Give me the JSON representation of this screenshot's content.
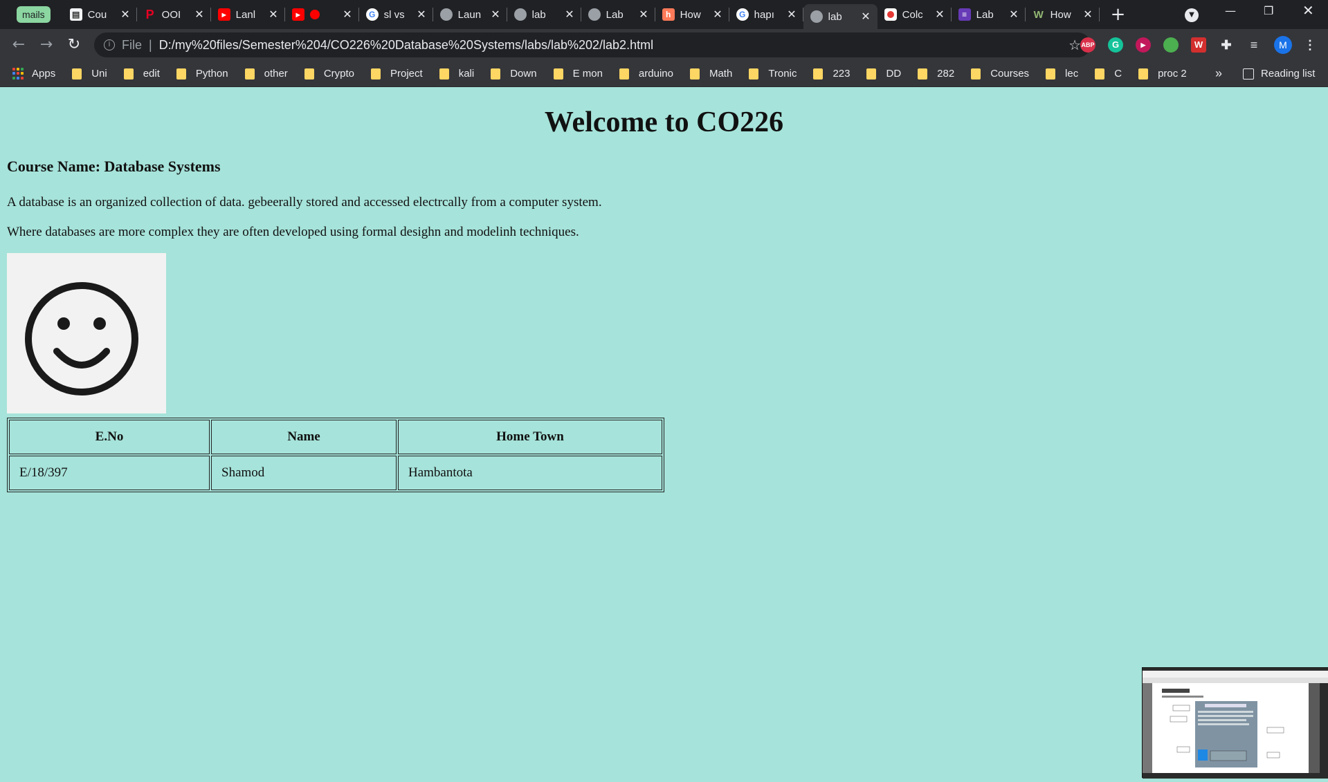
{
  "browser": {
    "tab_group_label": "mails",
    "tabs": [
      {
        "title": "Cou",
        "icon": "doc-icon",
        "color": "#f1f3f4",
        "active": false
      },
      {
        "title": "OOI",
        "icon": "pinterest-icon",
        "color": "#e60023",
        "active": false
      },
      {
        "title": "Lanl",
        "icon": "youtube-icon",
        "color": "#ff0000",
        "active": false
      },
      {
        "title": "",
        "icon": "youtube-icon",
        "color": "#ff0000",
        "active": false
      },
      {
        "title": "sl vs",
        "icon": "google-icon",
        "color": "#ffffff",
        "active": false
      },
      {
        "title": "Laun",
        "icon": "globe-icon",
        "color": "#9aa0a6",
        "active": false
      },
      {
        "title": "lab",
        "icon": "globe-icon",
        "color": "#9aa0a6",
        "active": false
      },
      {
        "title": "Lab",
        "icon": "globe-icon",
        "color": "#9aa0a6",
        "active": false
      },
      {
        "title": "How",
        "icon": "hubspot-icon",
        "color": "#ff7a59",
        "active": false
      },
      {
        "title": "hapı",
        "icon": "google-icon",
        "color": "#ffffff",
        "active": false
      },
      {
        "title": "lab",
        "icon": "globe-icon",
        "color": "#9aa0a6",
        "active": true
      },
      {
        "title": "Colc",
        "icon": "record-icon",
        "color": "#e53935",
        "active": false
      },
      {
        "title": "Lab",
        "icon": "list-icon",
        "color": "#673ab7",
        "active": false
      },
      {
        "title": "How",
        "icon": "wikihow-icon",
        "color": "#93b874",
        "active": false
      }
    ],
    "address": {
      "scheme_label": "File",
      "url": "D:/my%20files/Semester%204/CO226%20Database%20Systems/labs/lab%202/lab2.html"
    },
    "profile_initial": "M",
    "extensions": [
      {
        "label": "ABP",
        "color": "#d8304a"
      },
      {
        "label": "G",
        "color": "#15c39a"
      },
      {
        "label": "▶",
        "color": "#c2185b"
      },
      {
        "label": "",
        "color": "#4caf50"
      },
      {
        "label": "W",
        "color": "#d32f2f"
      }
    ],
    "bookmarks": [
      "Uni",
      "edit",
      "Python",
      "other",
      "Crypto",
      "Project",
      "kali",
      "Down",
      "E mon",
      "arduino",
      "Math",
      "Tronic",
      "223",
      "DD",
      "282",
      "Courses",
      "lec",
      "C",
      "proc 2"
    ],
    "apps_label": "Apps",
    "more_bookmarks": "»",
    "reading_list_label": "Reading list"
  },
  "page": {
    "heading": "Welcome to CO226",
    "subheading": "Course Name: Database Systems",
    "paragraph1": "A database is an organized collection of data. gebeerally stored and accessed electrcally from a computer system.",
    "paragraph2": "Where databases are more complex they are often developed using formal desighn and modelinh techniques.",
    "image_name": "smiley-face",
    "table": {
      "headers": [
        "E.No",
        "Name",
        "Home Town"
      ],
      "rows": [
        [
          "E/18/397",
          "Shamod",
          "Hambantota"
        ]
      ]
    },
    "background_color": "#a6e3da"
  }
}
